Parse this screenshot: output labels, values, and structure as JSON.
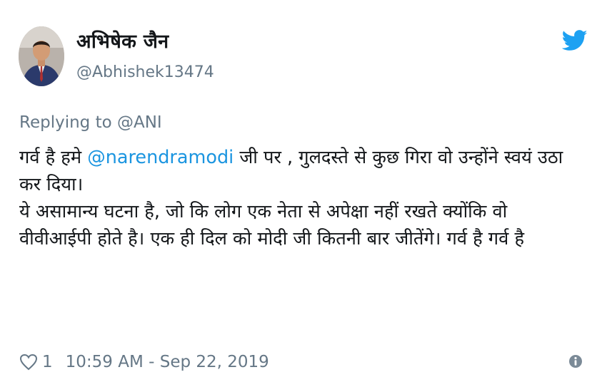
{
  "author": {
    "display_name": "अभिषेक जैन",
    "handle": "@Abhishek13474",
    "avatar": "avatar"
  },
  "brand": {
    "icon": "twitter-bird-icon",
    "color": "#1da1f2"
  },
  "reply": {
    "prefix": "Replying to ",
    "mention": "@ANI"
  },
  "tweet": {
    "line1_before": "गर्व है हमे ",
    "mention": "@narendramodi",
    "line1_after": " जी पर , गुलदस्ते से कुछ गिरा वो उन्होंने स्वयं उठा कर दिया।",
    "paragraph2": "ये असामान्य घटना है, जो कि लोग एक नेता से अपेक्षा नहीं रखते क्योंकि वो वीवीआईपी होते है। एक ही दिल को मोदी जी कितनी बार जीतेंगे। गर्व है गर्व है",
    "mention_color": "#1b95e0"
  },
  "footer": {
    "like_icon": "heart-icon",
    "like_count": "1",
    "timestamp": "10:59 AM - Sep 22, 2019",
    "info_icon": "info-icon"
  }
}
